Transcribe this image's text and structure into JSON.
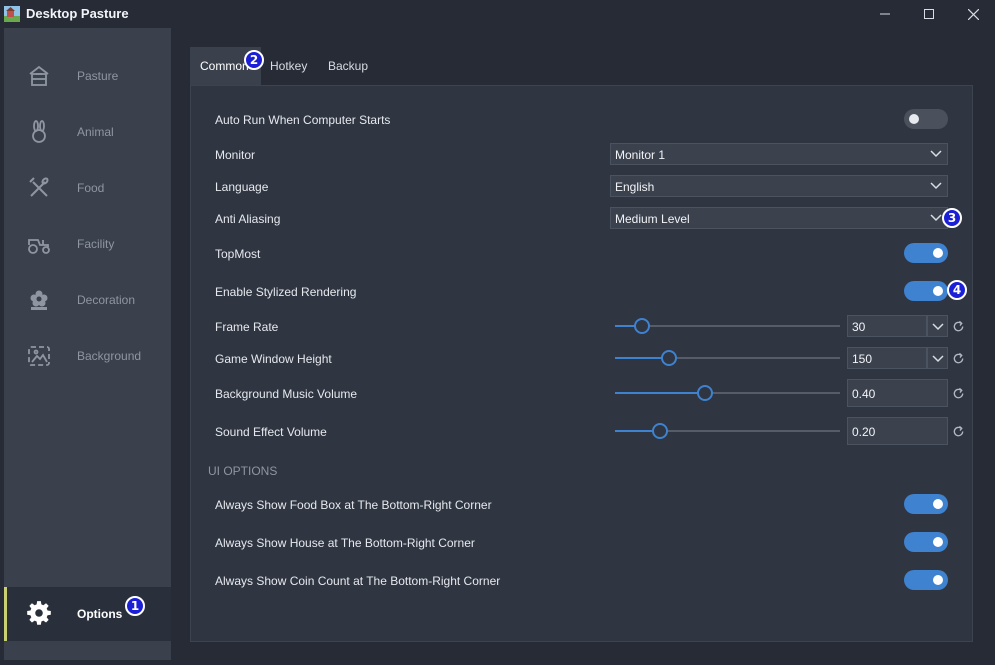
{
  "window": {
    "title": "Desktop Pasture"
  },
  "sidebar": {
    "items": [
      {
        "label": "Pasture",
        "icon": "barn-icon"
      },
      {
        "label": "Animal",
        "icon": "rabbit-icon"
      },
      {
        "label": "Food",
        "icon": "fork-spoon-icon"
      },
      {
        "label": "Facility",
        "icon": "tractor-icon"
      },
      {
        "label": "Decoration",
        "icon": "flower-icon"
      },
      {
        "label": "Background",
        "icon": "picture-icon"
      }
    ],
    "options": {
      "label": "Options",
      "icon": "gear-icon"
    }
  },
  "tabs": [
    "Common",
    "Hotkey",
    "Backup"
  ],
  "settings": {
    "auto_run": {
      "label": "Auto Run When Computer Starts",
      "on": false
    },
    "monitor": {
      "label": "Monitor",
      "value": "Monitor 1"
    },
    "language": {
      "label": "Language",
      "value": "English"
    },
    "anti_aliasing": {
      "label": "Anti Aliasing",
      "value": "Medium Level"
    },
    "topmost": {
      "label": "TopMost",
      "on": true
    },
    "stylized": {
      "label": "Enable Stylized Rendering",
      "on": true
    },
    "frame_rate": {
      "label": "Frame Rate",
      "value": "30",
      "slider_fraction": 0.12
    },
    "window_height": {
      "label": "Game Window Height",
      "value": "150",
      "slider_fraction": 0.24
    },
    "music_volume": {
      "label": "Background Music Volume",
      "value": "0.40",
      "slider_fraction": 0.4
    },
    "effect_volume": {
      "label": "Sound Effect Volume",
      "value": "0.20",
      "slider_fraction": 0.2
    }
  },
  "ui_options": {
    "section_label": "UI OPTIONS",
    "food_box": {
      "label": "Always Show Food Box at The Bottom-Right Corner",
      "on": true
    },
    "house": {
      "label": "Always Show House at The Bottom-Right Corner",
      "on": true
    },
    "coin": {
      "label": "Always Show Coin Count at The Bottom-Right Corner",
      "on": true
    }
  },
  "badges": [
    "1",
    "2",
    "3",
    "4"
  ],
  "colors": {
    "accent": "#3e82d0",
    "selected_bar": "#c9cf73",
    "badge": "#1b1fd6"
  }
}
